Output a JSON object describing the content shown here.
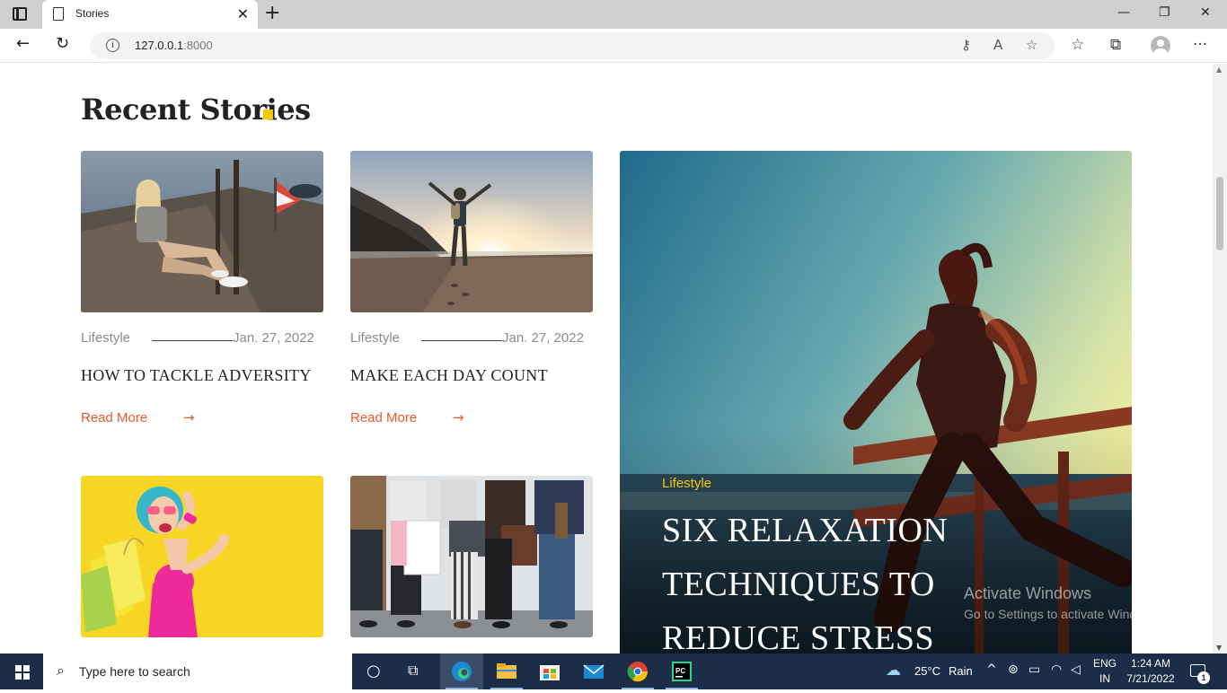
{
  "browser": {
    "tab_title": "Stories",
    "url_host": "127.0.0.1",
    "url_port": ":8000"
  },
  "page": {
    "section_title": "Recent Stories",
    "cards": [
      {
        "category": "Lifestyle",
        "date": "Jan. 27, 2022",
        "title": "HOW TO TACKLE ADVERSITY",
        "read_more": "Read More"
      },
      {
        "category": "Lifestyle",
        "date": "Jan. 27, 2022",
        "title": "MAKE EACH DAY COUNT",
        "read_more": "Read More"
      }
    ],
    "featured": {
      "category": "Lifestyle",
      "title": "SIX RELAXATION TECHNIQUES TO REDUCE STRESS"
    },
    "watermark": {
      "line1": "Activate Windows",
      "line2": "Go to Settings to activate Windows."
    }
  },
  "taskbar": {
    "search_placeholder": "Type here to search",
    "weather_temp": "25°C",
    "weather_text": "Rain",
    "lang_line1": "ENG",
    "lang_line2": "IN",
    "time": "1:24 AM",
    "date": "7/21/2022",
    "notification_count": "1"
  },
  "colors": {
    "accent": "#e8592b",
    "featured_category": "#f7c600",
    "title_dot": "#f5c800",
    "taskbar": "#1c2e47"
  }
}
